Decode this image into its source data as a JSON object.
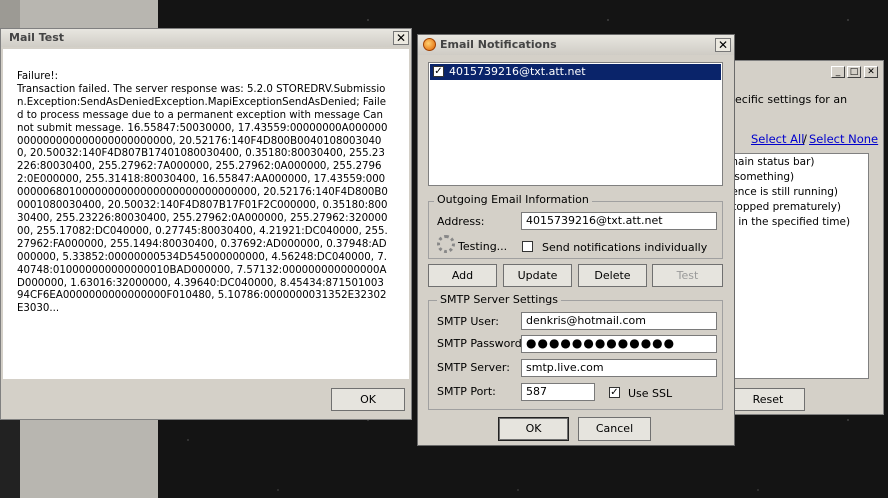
{
  "mail_test": {
    "title": "Mail Test",
    "close": "✕",
    "message": "Failure!:\nTransaction failed. The server response was: 5.2.0 STOREDRV.Submission.Exception:SendAsDeniedException.MapiExceptionSendAsDenied; Failed to process message due to a permanent exception with message Cannot submit message. 16.55847:50030000, 17.43559:00000000A000000000000000000000000000000, 20.52176:140F4D800B00401080030400, 20.50032:140F4D807B17401080030400, 0.35180:80030400, 255.23226:80030400, 255.27962:7A000000, 255.27962:0A000000, 255.27962:0E000000, 255.31418:80030400, 16.55847:AA000000, 17.43559:0000000068010000000000000000000000000000, 20.52176:140F4D800B00001080030400, 20.50032:140F4D807B17F01F2C000000, 0.35180:80030400, 255.23226:80030400, 255.27962:0A000000, 255.27962:32000000, 255.17082:DC040000, 0.27745:80030400, 4.21921:DC040000, 255.27962:FA000000, 255.1494:80030400, 0.37692:AD000000, 0.37948:AD000000, 5.33852:00000000534D545000000000, 4.56248:DC040000, 7.40748:010000000000000010BAD000000, 7.57132:000000000000000AD000000, 1.63016:32000000, 4.39640:DC040000, 8.45434:87150100394CF6EA0000000000000000F010480, 5.10786:0000000031352E32302E3030...",
    "ok_label": "OK"
  },
  "back_window": {
    "min": "_",
    "max": "□",
    "close": "✕",
    "description": "ecific settings for an",
    "select_all": "Select All",
    "separator": "/",
    "select_none": "Select None",
    "list_items": [
      "e main status bar)",
      "do something)",
      "quence is still running)",
      "s stopped prematurely)",
      "ete in the specified time)"
    ],
    "reset_label": "Reset"
  },
  "email_notifications": {
    "title": "Email Notifications",
    "close": "✕",
    "recipients": [
      {
        "checked": true,
        "address": "4015739216@txt.att.net",
        "check_glyph": "✓"
      }
    ],
    "outgoing": {
      "title": "Outgoing Email Information",
      "address_label": "Address:",
      "address_value": "4015739216@txt.att.net",
      "testing_label": "Testing...",
      "individual_label": "Send notifications individually",
      "individual_checked": false
    },
    "buttons": {
      "add": "Add",
      "update": "Update",
      "delete": "Delete",
      "test": "Test"
    },
    "smtp": {
      "title": "SMTP Server Settings",
      "user_label": "SMTP User:",
      "user_value": "denkris@hotmail.com",
      "password_label": "SMTP Password:",
      "password_value": "●●●●●●●●●●●●●",
      "server_label": "SMTP Server:",
      "server_value": "smtp.live.com",
      "port_label": "SMTP Port:",
      "port_value": "587",
      "ssl_label": "Use SSL",
      "ssl_checked": true,
      "ssl_glyph": "✓"
    },
    "ok_label": "OK",
    "cancel_label": "Cancel"
  },
  "colors": {
    "selection": "#0a246a",
    "link": "#0000cc",
    "dialog_face": "#d4d0c8"
  }
}
